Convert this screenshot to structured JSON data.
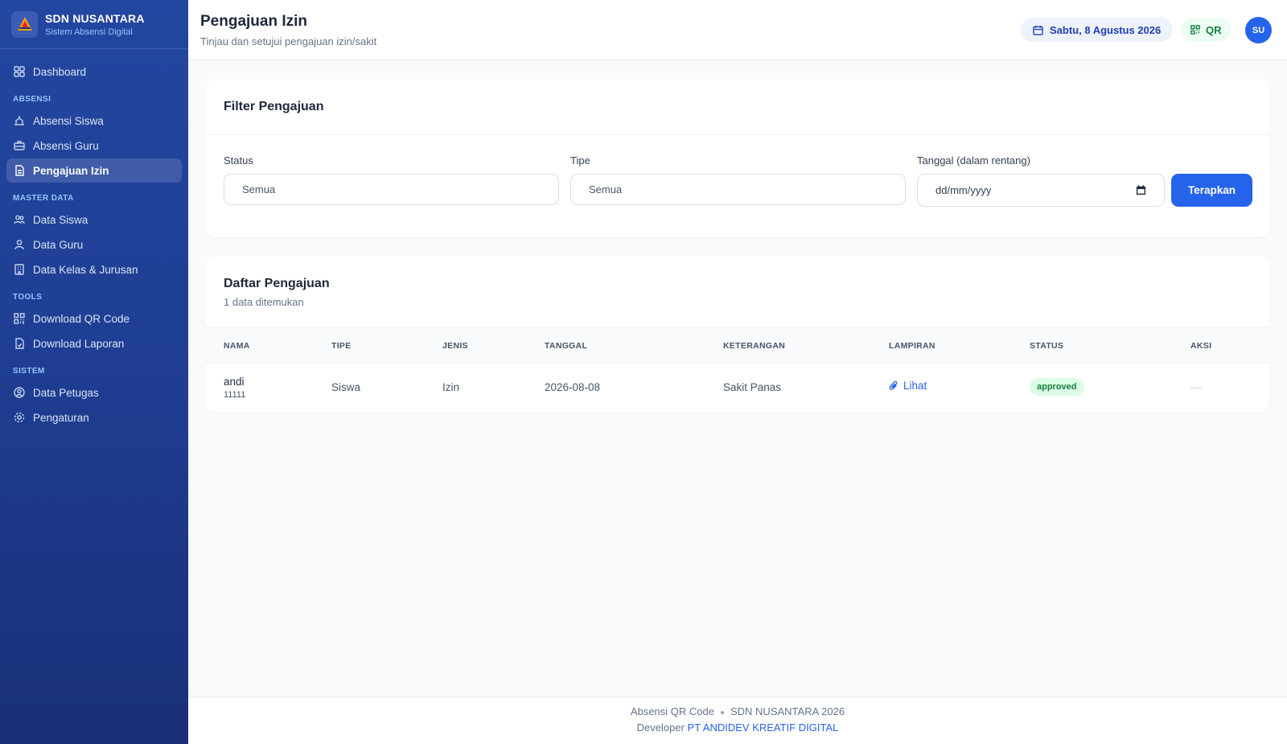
{
  "sidebar": {
    "brand_name": "SDN NUSANTARA",
    "brand_sub": "Sistem Absensi Digital",
    "dashboard": "Dashboard",
    "sections": {
      "absensi": "ABSENSI",
      "master": "MASTER DATA",
      "tools": "TOOLS",
      "sistem": "SISTEM"
    },
    "items": {
      "absensi_siswa": "Absensi Siswa",
      "absensi_guru": "Absensi Guru",
      "pengajuan_izin": "Pengajuan Izin",
      "data_siswa": "Data Siswa",
      "data_guru": "Data Guru",
      "data_kelas": "Data Kelas & Jurusan",
      "download_qr": "Download QR Code",
      "download_laporan": "Download Laporan",
      "data_petugas": "Data Petugas",
      "pengaturan": "Pengaturan"
    },
    "active_item": "pengajuan_izin"
  },
  "header": {
    "title": "Pengajuan Izin",
    "subtitle": "Tinjau dan setujui pengajuan izin/sakit",
    "date": "Sabtu, 8 Agustus 2026",
    "qr_label": "QR",
    "avatar_initials": "SU"
  },
  "filter": {
    "title": "Filter Pengajuan",
    "status_label": "Status",
    "status_value": "Semua",
    "tipe_label": "Tipe",
    "tipe_value": "Semua",
    "tanggal_label": "Tanggal (dalam rentang)",
    "tanggal_placeholder": "dd/mm/yyyy",
    "apply_label": "Terapkan"
  },
  "list": {
    "title": "Daftar Pengajuan",
    "count_text": "1 data ditemukan",
    "columns": [
      "NAMA",
      "TIPE",
      "JENIS",
      "TANGGAL",
      "KETERANGAN",
      "LAMPIRAN",
      "STATUS",
      "AKSI"
    ],
    "rows": [
      {
        "nama": "andi",
        "nis": "11111",
        "tipe": "Siswa",
        "jenis": "Izin",
        "tanggal": "2026-08-08",
        "keterangan": "Sakit Panas",
        "lampiran": "Lihat",
        "status": "approved",
        "aksi": "—"
      }
    ]
  },
  "footer": {
    "app": "Absensi QR Code",
    "org": "SDN NUSANTARA 2026",
    "dev_prefix": "Developer",
    "dev_name": "PT ANDIDEV KREATIF DIGITAL"
  },
  "colors": {
    "sidebar": "#2346a0",
    "primary": "#2563eb",
    "approved_bg": "#dcfce7",
    "approved_text": "#15803d"
  },
  "icons": {
    "dashboard": "grid-icon",
    "absensi_siswa": "student-icon",
    "absensi_guru": "briefcase-icon",
    "pengajuan_izin": "document-icon",
    "data_siswa": "users-icon",
    "data_guru": "user-icon",
    "data_kelas": "building-icon",
    "download_qr": "qr-icon",
    "download_laporan": "file-icon",
    "data_petugas": "user-circle-icon",
    "pengaturan": "gear-icon",
    "calendar": "calendar-icon",
    "lampiran": "paperclip-icon"
  }
}
